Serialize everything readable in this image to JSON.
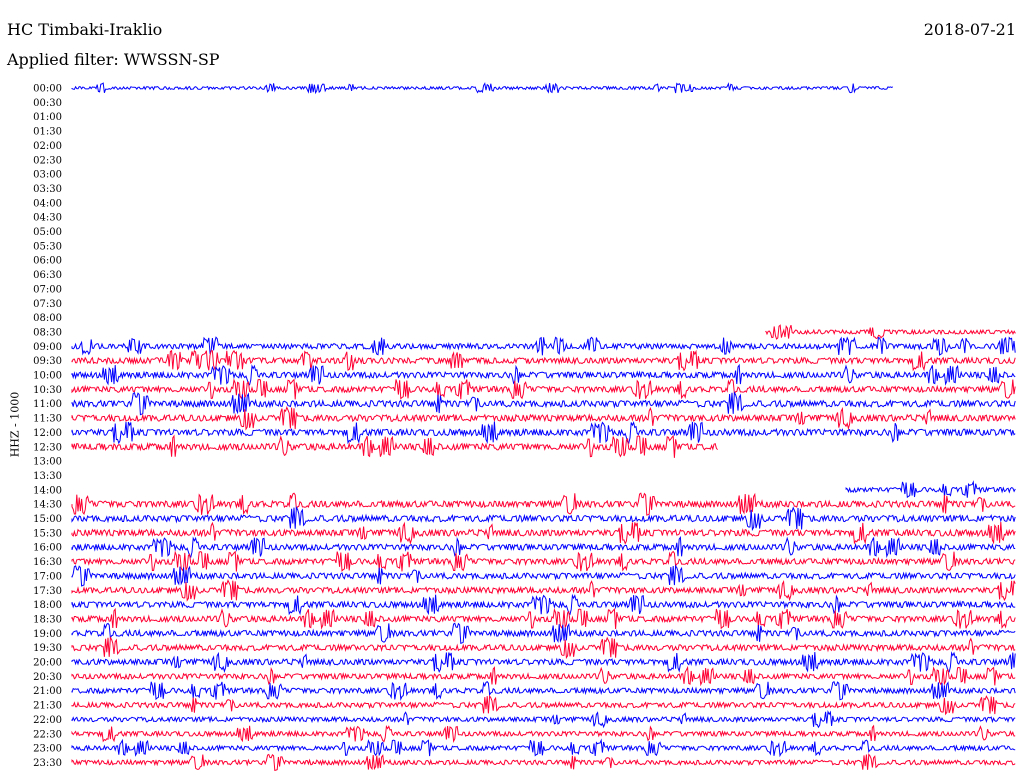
{
  "header": {
    "station": "HC Timbaki-Iraklio",
    "date": "2018-07-21",
    "filter": "Applied filter: WWSSN-SP",
    "channel": "HHZ - 1000"
  },
  "chart_data": {
    "type": "line",
    "title": "HC Timbaki-Iraklio",
    "subtitle": "Applied filter: WWSSN-SP",
    "ylabel": "HHZ - 1000",
    "xlabel": "",
    "colors": [
      "#0000ff",
      "#ff0033"
    ],
    "time_labels": [
      "00:00",
      "00:30",
      "01:00",
      "01:30",
      "02:00",
      "02:30",
      "03:00",
      "03:30",
      "04:00",
      "04:30",
      "05:00",
      "05:30",
      "06:00",
      "06:30",
      "07:00",
      "07:30",
      "08:00",
      "08:30",
      "09:00",
      "09:30",
      "10:00",
      "10:30",
      "11:00",
      "11:30",
      "12:00",
      "12:30",
      "13:00",
      "13:30",
      "14:00",
      "14:30",
      "15:00",
      "15:30",
      "16:00",
      "16:30",
      "17:00",
      "17:30",
      "18:00",
      "18:30",
      "19:00",
      "19:30",
      "20:00",
      "20:30",
      "21:00",
      "21:30",
      "22:00",
      "22:30",
      "23:00",
      "23:30"
    ],
    "traces": [
      {
        "row": 0,
        "start": 0.0,
        "end": 0.87,
        "amp": 0.25
      },
      {
        "row": 17,
        "start": 0.735,
        "end": 1.0,
        "amp": 0.35
      },
      {
        "row": 18,
        "start": 0.0,
        "end": 1.0,
        "amp": 0.45
      },
      {
        "row": 19,
        "start": 0.0,
        "end": 1.0,
        "amp": 0.5
      },
      {
        "row": 20,
        "start": 0.0,
        "end": 1.0,
        "amp": 0.5
      },
      {
        "row": 21,
        "start": 0.0,
        "end": 1.0,
        "amp": 0.5
      },
      {
        "row": 22,
        "start": 0.0,
        "end": 1.0,
        "amp": 0.55
      },
      {
        "row": 23,
        "start": 0.0,
        "end": 1.0,
        "amp": 0.55
      },
      {
        "row": 24,
        "start": 0.0,
        "end": 1.0,
        "amp": 0.55
      },
      {
        "row": 25,
        "start": 0.0,
        "end": 0.685,
        "amp": 0.55
      },
      {
        "row": 28,
        "start": 0.82,
        "end": 1.0,
        "amp": 0.4
      },
      {
        "row": 29,
        "start": 0.0,
        "end": 1.0,
        "amp": 0.55
      },
      {
        "row": 30,
        "start": 0.0,
        "end": 1.0,
        "amp": 0.55
      },
      {
        "row": 31,
        "start": 0.0,
        "end": 1.0,
        "amp": 0.55
      },
      {
        "row": 32,
        "start": 0.0,
        "end": 1.0,
        "amp": 0.5
      },
      {
        "row": 33,
        "start": 0.0,
        "end": 1.0,
        "amp": 0.5
      },
      {
        "row": 34,
        "start": 0.0,
        "end": 1.0,
        "amp": 0.5
      },
      {
        "row": 35,
        "start": 0.0,
        "end": 1.0,
        "amp": 0.5
      },
      {
        "row": 36,
        "start": 0.0,
        "end": 1.0,
        "amp": 0.5
      },
      {
        "row": 37,
        "start": 0.0,
        "end": 1.0,
        "amp": 0.5
      },
      {
        "row": 38,
        "start": 0.0,
        "end": 1.0,
        "amp": 0.5
      },
      {
        "row": 39,
        "start": 0.0,
        "end": 1.0,
        "amp": 0.5
      },
      {
        "row": 40,
        "start": 0.0,
        "end": 1.0,
        "amp": 0.5
      },
      {
        "row": 41,
        "start": 0.0,
        "end": 1.0,
        "amp": 0.45
      },
      {
        "row": 42,
        "start": 0.0,
        "end": 1.0,
        "amp": 0.45
      },
      {
        "row": 43,
        "start": 0.0,
        "end": 1.0,
        "amp": 0.45
      },
      {
        "row": 44,
        "start": 0.0,
        "end": 1.0,
        "amp": 0.4
      },
      {
        "row": 45,
        "start": 0.0,
        "end": 1.0,
        "amp": 0.4
      },
      {
        "row": 46,
        "start": 0.0,
        "end": 1.0,
        "amp": 0.4
      },
      {
        "row": 47,
        "start": 0.0,
        "end": 1.0,
        "amp": 0.4
      }
    ]
  }
}
